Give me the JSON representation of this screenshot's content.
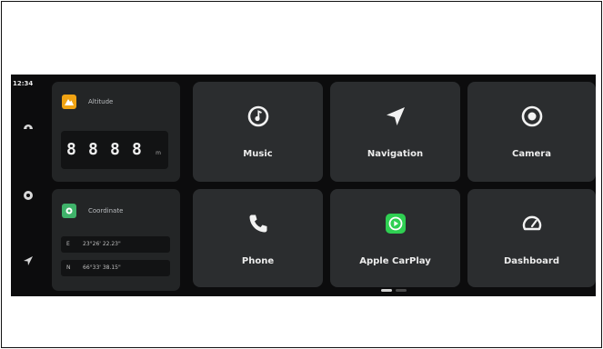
{
  "status": {
    "time": "12:34"
  },
  "rail": {
    "icons": [
      "speedometer-icon",
      "settings-icon",
      "navigation-arrow-icon"
    ]
  },
  "altitude": {
    "title": "Altitude",
    "digits": [
      "8",
      "8",
      "8",
      "8"
    ],
    "unit": "m",
    "accent": "#f0a313"
  },
  "coordinate": {
    "title": "Coordinate",
    "accent": "#3fb36a",
    "rows": [
      {
        "axis": "E",
        "value": "23°26' 22.23\""
      },
      {
        "axis": "N",
        "value": "66°33' 38.15\""
      }
    ]
  },
  "apps": [
    {
      "label": "Music",
      "icon": "music-icon"
    },
    {
      "label": "Navigation",
      "icon": "navigation-icon"
    },
    {
      "label": "Camera",
      "icon": "camera-icon"
    },
    {
      "label": "Phone",
      "icon": "phone-icon"
    },
    {
      "label": "Apple CarPlay",
      "icon": "carplay-icon",
      "accent": "#2fcf52"
    },
    {
      "label": "Dashboard",
      "icon": "dashboard-gauge-icon"
    }
  ],
  "pager": {
    "pages": 2,
    "active": 1
  }
}
